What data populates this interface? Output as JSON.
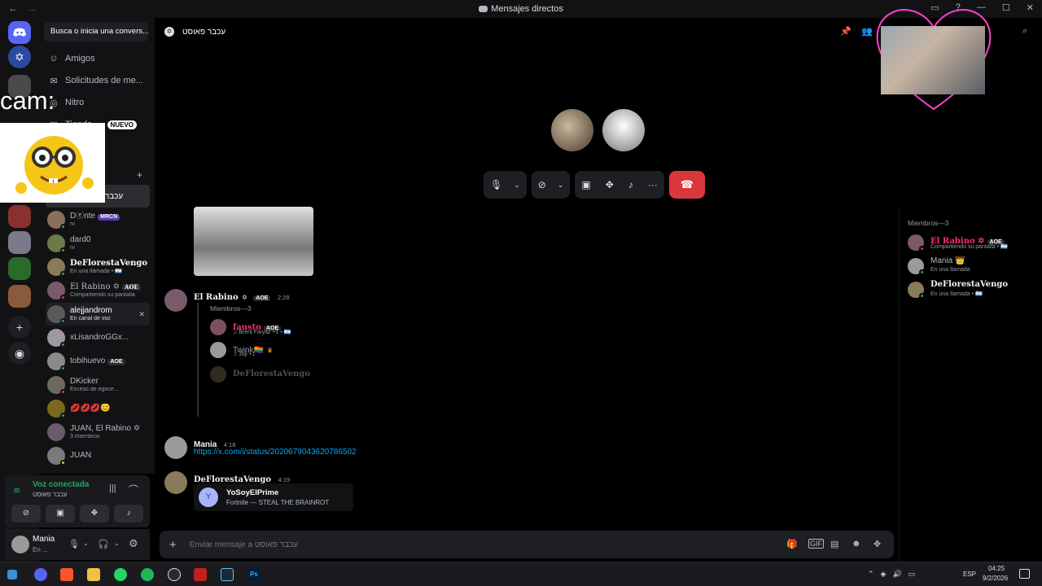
{
  "window": {
    "title": "Mensajes directos"
  },
  "dm_sidebar": {
    "search_label": "Busca o inicia una convers...",
    "nav_items": [
      {
        "label": "Amigos",
        "icon": "person-wave-icon"
      },
      {
        "label": "Solicitudes de me...",
        "icon": "envelope-icon"
      },
      {
        "label": "Nitro",
        "icon": "nitro-icon"
      },
      {
        "label": "Tienda",
        "icon": "shop-icon",
        "badge": "NUEVO"
      }
    ],
    "active_dm_label": "עכבר פאוסט",
    "dms": [
      {
        "name": "Dⓔnte",
        "tag": "MRCN",
        "sub": "rv",
        "status_color": "#23a55a"
      },
      {
        "name": "dard0",
        "sub": "rv",
        "status_color": "#23a55a"
      },
      {
        "name": "DeFlorestaVengo",
        "sub": "En una llamada • 🇦🇷",
        "status_color": "#23a55a"
      },
      {
        "name": "El Rabino ✡",
        "tag": "AOE",
        "sub": "Compartiendo su pantalla",
        "status_color": "#da373c"
      },
      {
        "name": "alejjandrom",
        "sub": "En canal de voz",
        "status_color": "#23a55a"
      },
      {
        "name": "xLisandroGGx...",
        "sub": "",
        "status_color": "#23a55a"
      },
      {
        "name": "tobihuevo",
        "tag": "AOE",
        "sub": "",
        "status_color": "#23a55a"
      },
      {
        "name": "DKicker",
        "sub": "Exceso de egoce...",
        "status_color": "#da373c"
      },
      {
        "name": "💋💋💋😊",
        "sub": "",
        "status_color": "#23a55a"
      },
      {
        "name": "JUAN, El Rabino ✡",
        "sub": "3 miembros",
        "status_color": ""
      },
      {
        "name": "JUAN",
        "sub": "",
        "status_color": "#f0b232"
      }
    ],
    "close_glyph": "✕"
  },
  "voice_panel": {
    "title": "Voz conectada",
    "channel": "עכבר פאוסט"
  },
  "user_panel": {
    "name": "Mania",
    "sub": "En ..."
  },
  "header": {
    "channel_name": "עכבר פאוסט"
  },
  "overlays": {
    "cam_text": "cam:"
  },
  "chat": {
    "messages": [
      {
        "author": "El Rabino",
        "tag": "AOE",
        "time": "2:28",
        "embed_title": "Miembros—3",
        "embed_members": [
          {
            "name": "fausto",
            "tag": "AOE",
            "sub": "♫ Brent Faiyaz +1 • 🇦🇷"
          },
          {
            "name": "Twink🏳️‍🌈",
            "sub": "♫ Joji +1"
          },
          {
            "name": "DeFlorestaVengo",
            "sub": ""
          }
        ]
      },
      {
        "author": "Mania",
        "time": "4:18",
        "link": "https://x.com/i/status/2020679043620786502"
      },
      {
        "author": "DeFlorestaVengo",
        "time": "4:19",
        "card_title": "YoSoyElPrime",
        "card_sub": "Fortnite — STEAL THE BRAINROT"
      }
    ],
    "composer_placeholder": "Enviar mensaje a עכבר פאוסט"
  },
  "members_panel": {
    "title": "Miembros—3",
    "members": [
      {
        "name": "El Rabino ✡",
        "tag": "AOE",
        "sub": "Compartiendo su pantalla • 🇦🇷",
        "color": "#ff2d6f",
        "status_color": "#da373c"
      },
      {
        "name": "Mania 👑",
        "sub": "En una llamada",
        "color": "#b5bac1",
        "status_color": "#23a55a"
      },
      {
        "name": "DeFlorestaVengo",
        "sub": "En una llamada • 🇦🇷",
        "color": "#f2f3f5",
        "status_color": "#23a55a"
      }
    ]
  },
  "taskbar": {
    "lang": "ESP",
    "time": "04:25",
    "date": "9/2/2026"
  },
  "colors": {
    "accent": "#5865f2",
    "danger": "#da373c",
    "link": "#00a8fc",
    "online": "#23a55a"
  }
}
